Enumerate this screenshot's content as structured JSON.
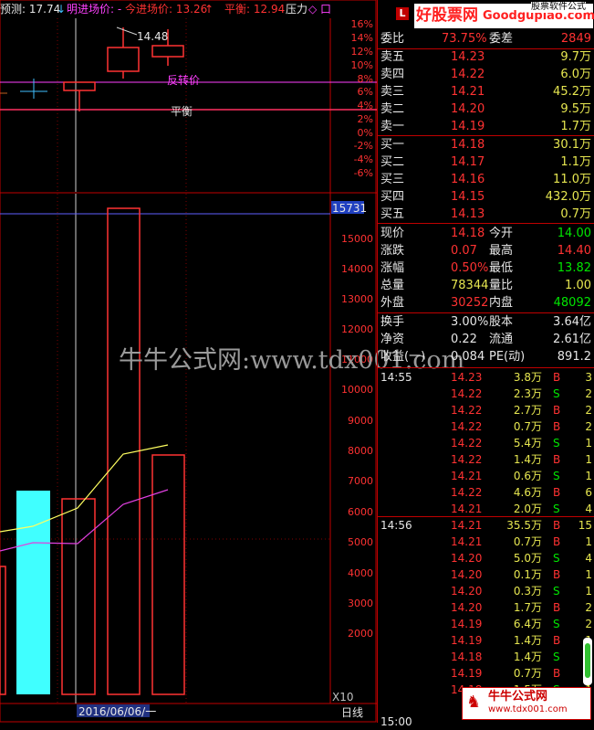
{
  "top_bar": {
    "forecast": "预测: 17.74",
    "tomorrow_entry": "明进场价: -",
    "today_entry": "今进场价: 13.26",
    "balance": "平衡: 12.94",
    "pressure": "压力",
    "symbols": "◇ 口"
  },
  "chart": {
    "price_label_14_48": "14.48",
    "reversal_label": "反转价",
    "balance_label": "平衡",
    "pct_axis": [
      "16%",
      "14%",
      "12%",
      "10%",
      "8%",
      "6%",
      "4%",
      "2%",
      "0%",
      "-2%",
      "-4%",
      "-6%"
    ],
    "vol_axis": [
      "15000",
      "14000",
      "13000",
      "12000",
      "11000",
      "10000",
      "9000",
      "8000",
      "7000",
      "6000",
      "5000",
      "4000",
      "3000",
      "2000"
    ],
    "vol_current": "15731",
    "unit": "X10",
    "date_label": "2016/06/06/一",
    "period_label": "日线",
    "colors": {
      "volume_bar_highlight": "#40ffff",
      "ma_yellow": "#ffff60",
      "ma_purple": "#e040e0",
      "up": "#ff4040"
    }
  },
  "watermark": {
    "center": "牛牛公式网:www.tdx001.com",
    "top_brand": "好股票网",
    "top_url": "Goodgupiao.com",
    "top_tag": "股票软件公式",
    "bottom": "牛牛公式网",
    "bottom_url": "www.tdx001.com"
  },
  "panel": {
    "header_label": "L",
    "weibi": {
      "label": "委比",
      "value": "73.75%",
      "label2": "委差",
      "value2": "2849"
    },
    "asks": [
      {
        "label": "卖五",
        "price": "14.23",
        "vol": "9.7万"
      },
      {
        "label": "卖四",
        "price": "14.22",
        "vol": "6.0万"
      },
      {
        "label": "卖三",
        "price": "14.21",
        "vol": "45.2万"
      },
      {
        "label": "卖二",
        "price": "14.20",
        "vol": "9.5万"
      },
      {
        "label": "卖一",
        "price": "14.19",
        "vol": "1.7万"
      }
    ],
    "bids": [
      {
        "label": "买一",
        "price": "14.18",
        "vol": "30.1万"
      },
      {
        "label": "买二",
        "price": "14.17",
        "vol": "1.1万"
      },
      {
        "label": "买三",
        "price": "14.16",
        "vol": "11.0万"
      },
      {
        "label": "买四",
        "price": "14.15",
        "vol": "432.0万"
      },
      {
        "label": "买五",
        "price": "14.13",
        "vol": "0.7万"
      }
    ],
    "quote": [
      {
        "l1": "现价",
        "v1": "14.18",
        "l2": "今开",
        "v2": "14.00"
      },
      {
        "l1": "涨跌",
        "v1": "0.07",
        "l2": "最高",
        "v2": "14.40"
      },
      {
        "l1": "涨幅",
        "v1": "0.50%",
        "l2": "最低",
        "v2": "13.82"
      },
      {
        "l1": "总量",
        "v1": "78344",
        "l2": "量比",
        "v2": "1.00"
      },
      {
        "l1": "外盘",
        "v1": "30252",
        "l2": "内盘",
        "v2": "48092"
      }
    ],
    "stats": [
      {
        "l1": "换手",
        "v1": "3.00%",
        "l2": "股本",
        "v2": "3.64亿"
      },
      {
        "l1": "净资",
        "v1": "0.22",
        "l2": "流通",
        "v2": "2.61亿"
      },
      {
        "l1": "收益(一)",
        "v1": "0.084",
        "l2": "PE(动)",
        "v2": "891.2"
      }
    ],
    "ticks_1": {
      "time": "14:55",
      "rows": [
        {
          "p": "14.23",
          "v": "3.8万",
          "s": "B",
          "n": "3"
        },
        {
          "p": "14.22",
          "v": "2.3万",
          "s": "S",
          "n": "2"
        },
        {
          "p": "14.22",
          "v": "2.7万",
          "s": "B",
          "n": "2"
        },
        {
          "p": "14.22",
          "v": "0.7万",
          "s": "B",
          "n": "2"
        },
        {
          "p": "14.22",
          "v": "5.4万",
          "s": "S",
          "n": "1"
        },
        {
          "p": "14.22",
          "v": "1.4万",
          "s": "B",
          "n": "1"
        },
        {
          "p": "14.21",
          "v": "0.6万",
          "s": "S",
          "n": "1"
        },
        {
          "p": "14.22",
          "v": "4.6万",
          "s": "B",
          "n": "6"
        },
        {
          "p": "14.21",
          "v": "2.0万",
          "s": "S",
          "n": "4"
        }
      ]
    },
    "ticks_2": {
      "time": "14:56",
      "rows": [
        {
          "p": "14.21",
          "v": "35.5万",
          "s": "B",
          "n": "15"
        },
        {
          "p": "14.21",
          "v": "0.7万",
          "s": "B",
          "n": "1"
        },
        {
          "p": "14.20",
          "v": "5.0万",
          "s": "S",
          "n": "4"
        },
        {
          "p": "14.20",
          "v": "0.1万",
          "s": "B",
          "n": "1"
        },
        {
          "p": "14.20",
          "v": "0.3万",
          "s": "S",
          "n": "1"
        },
        {
          "p": "14.20",
          "v": "1.7万",
          "s": "B",
          "n": "2"
        },
        {
          "p": "14.19",
          "v": "6.4万",
          "s": "S",
          "n": "2"
        },
        {
          "p": "14.19",
          "v": "1.4万",
          "s": "B",
          "n": "1"
        },
        {
          "p": "14.18",
          "v": "1.4万",
          "s": "S",
          "n": "1"
        },
        {
          "p": "14.19",
          "v": "0.7万",
          "s": "B",
          "n": "1"
        },
        {
          "p": "14.18",
          "v": "1.5万",
          "s": "S",
          "n": "1"
        }
      ]
    },
    "ticks_3_time": "15:00"
  }
}
